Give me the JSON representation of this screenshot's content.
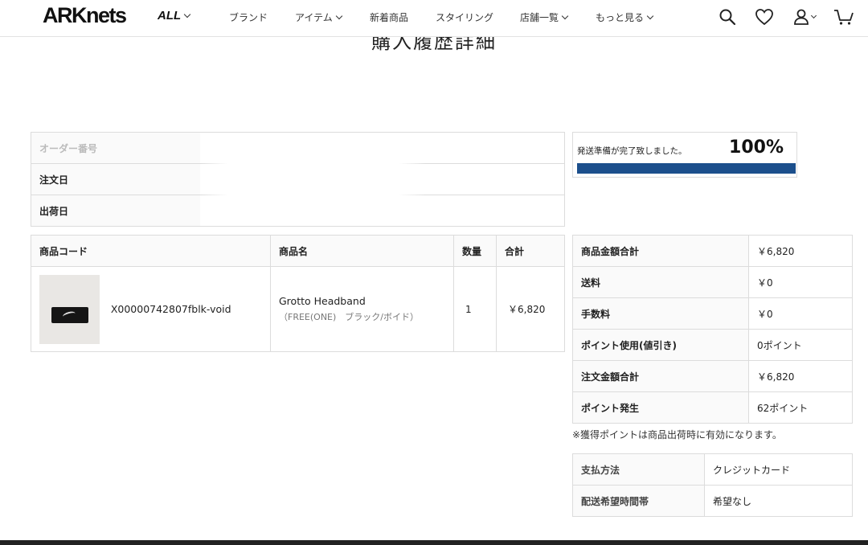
{
  "header": {
    "logo": "ARKnets",
    "all_label": "ALL",
    "nav": [
      {
        "label": "ブランド",
        "dropdown": false
      },
      {
        "label": "アイテム",
        "dropdown": true
      },
      {
        "label": "新着商品",
        "dropdown": false
      },
      {
        "label": "スタイリング",
        "dropdown": false
      },
      {
        "label": "店舗一覧",
        "dropdown": true
      },
      {
        "label": "もっと見る",
        "dropdown": true
      }
    ],
    "icons": [
      "search-icon",
      "heart-icon",
      "user-icon",
      "cart-icon"
    ]
  },
  "page_title": "購入履歴詳細",
  "order_info": {
    "rows": [
      {
        "label": "オーダー番号",
        "value": ""
      },
      {
        "label": "注文日",
        "value": ""
      },
      {
        "label": "出荷日",
        "value": ""
      }
    ]
  },
  "progress": {
    "message": "発送準備が完了致しました。",
    "percent_label": "100%",
    "percent": 100,
    "color": "#1c4f8c"
  },
  "items_table": {
    "headers": {
      "code": "商品コード",
      "name": "商品名",
      "qty": "数量",
      "total": "合計"
    },
    "rows": [
      {
        "code": "X00000742807fblk-void",
        "name": "Grotto Headband",
        "variant": "（FREE(ONE)　ブラック/ボイド）",
        "qty": "1",
        "total": "￥6,820"
      }
    ]
  },
  "summary": {
    "rows": [
      {
        "label": "商品金額合計",
        "value": "￥6,820"
      },
      {
        "label": "送料",
        "value": "￥0"
      },
      {
        "label": "手数料",
        "value": "￥0"
      },
      {
        "label": "ポイント使用(値引き)",
        "value": "0ポイント"
      },
      {
        "label": "注文金額合計",
        "value": "￥6,820"
      },
      {
        "label": "ポイント発生",
        "value": "62ポイント"
      }
    ]
  },
  "note": "※獲得ポイントは商品出荷時に有効になります。",
  "payment": {
    "rows": [
      {
        "label": "支払方法",
        "value": "クレジットカード"
      },
      {
        "label": "配送希望時間帯",
        "value": "希望なし"
      }
    ]
  }
}
